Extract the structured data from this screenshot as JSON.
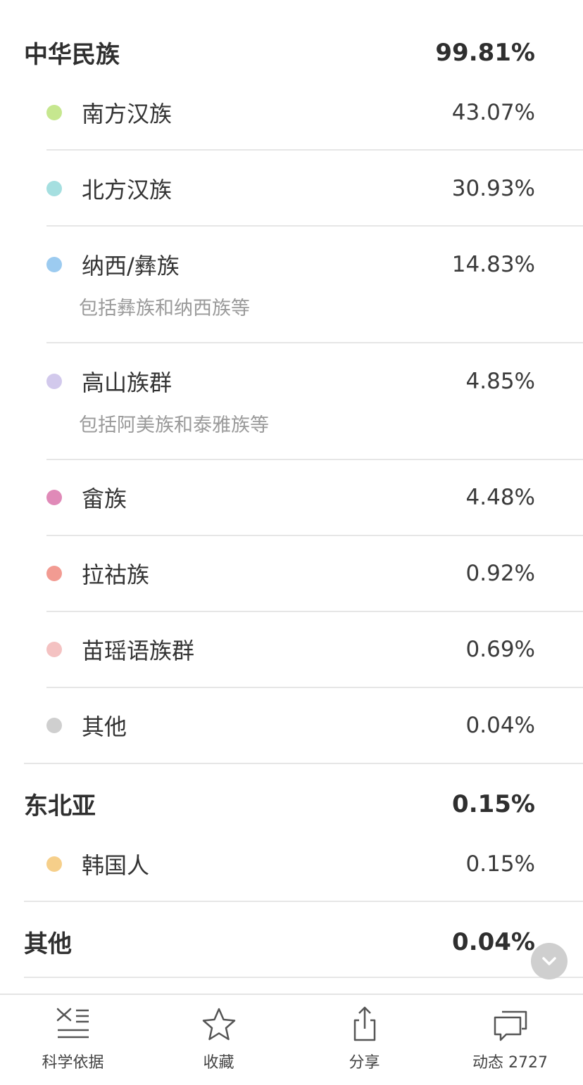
{
  "groups": [
    {
      "name": "中华民族",
      "value": "99.81%",
      "items": [
        {
          "label": "南方汉族",
          "value": "43.07%",
          "color": "#c6e78f"
        },
        {
          "label": "北方汉族",
          "value": "30.93%",
          "color": "#a5dfe0"
        },
        {
          "label": "纳西/彝族",
          "value": "14.83%",
          "color": "#9ccbf0",
          "note": "包括彝族和纳西族等"
        },
        {
          "label": "高山族群",
          "value": "4.85%",
          "color": "#d2c9ec",
          "note": "包括阿美族和泰雅族等"
        },
        {
          "label": "畲族",
          "value": "4.48%",
          "color": "#e08ab8"
        },
        {
          "label": "拉祜族",
          "value": "0.92%",
          "color": "#f29b92"
        },
        {
          "label": "苗瑶语族群",
          "value": "0.69%",
          "color": "#f4c2c2"
        },
        {
          "label": "其他",
          "value": "0.04%",
          "color": "#cfcfcf"
        }
      ]
    },
    {
      "name": "东北亚",
      "value": "0.15%",
      "items": [
        {
          "label": "韩国人",
          "value": "0.15%",
          "color": "#f6cf8a"
        }
      ]
    },
    {
      "name": "其他",
      "value": "0.04%",
      "items": []
    }
  ],
  "tabbar": {
    "science": "科学依据",
    "favorite": "收藏",
    "share": "分享",
    "activity": "动态 2727"
  },
  "icons": {
    "science": "dna-list-icon",
    "favorite": "star-icon",
    "share": "share-icon",
    "activity": "chat-bubbles-icon",
    "scroll": "chevron-down-icon"
  }
}
